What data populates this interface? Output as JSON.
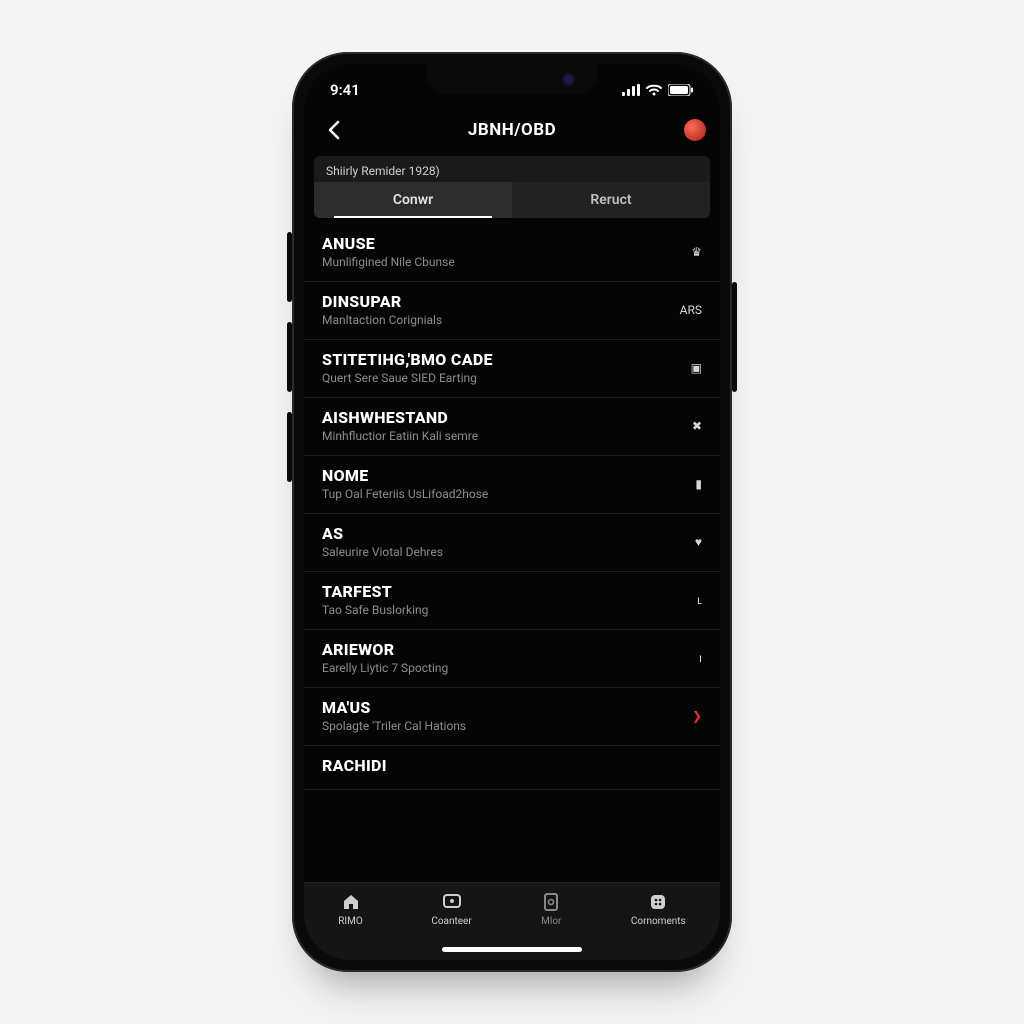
{
  "status": {
    "time": "9:41"
  },
  "header": {
    "title": "JBNH/OBD"
  },
  "sub": {
    "label": "Shiirly Remider 1928)"
  },
  "tabs": [
    {
      "label": "Conwr",
      "active": true
    },
    {
      "label": "Reruct",
      "active": false
    }
  ],
  "items": [
    {
      "title": "ANUSE",
      "subtitle": "Munlifigined Nile Cbunse",
      "indicator": "♛",
      "red": false
    },
    {
      "title": "DINSUPAR",
      "subtitle": "Manltaction Corignials",
      "indicator": "ARS",
      "red": false
    },
    {
      "title": "STITETIHG,'BMO CADE",
      "subtitle": "Quert Sere Saue SIED Earting",
      "indicator": "▣",
      "red": false
    },
    {
      "title": "AISHWHESTAND",
      "subtitle": "Minhfluctior Eatiin Kali semre",
      "indicator": "✖",
      "red": false
    },
    {
      "title": "NOME",
      "subtitle": "Tup Oal Feteriis UsLifoad2hose",
      "indicator": "▮",
      "red": false
    },
    {
      "title": "AS",
      "subtitle": "Saleurire Viotal Dehres",
      "indicator": "♥",
      "red": false
    },
    {
      "title": "TARFEST",
      "subtitle": "Tao Safe Buslorking",
      "indicator": "ʟ",
      "red": false
    },
    {
      "title": "ARIEWOR",
      "subtitle": "Earelly Liytic 7 Spocting",
      "indicator": "ı",
      "red": false
    },
    {
      "title": "MA'US",
      "subtitle": "Spolagte 'Triler Cal Hations",
      "indicator": "❯",
      "red": true
    },
    {
      "title": "RACHIDI",
      "subtitle": "",
      "indicator": "",
      "red": false
    }
  ],
  "tabbar": [
    {
      "label": "RIMO",
      "icon": "home",
      "active": true
    },
    {
      "label": "Coanteer",
      "icon": "monitor",
      "active": true
    },
    {
      "label": "Mlor",
      "icon": "doc",
      "active": false
    },
    {
      "label": "Cornoments",
      "icon": "grid",
      "active": true
    }
  ]
}
